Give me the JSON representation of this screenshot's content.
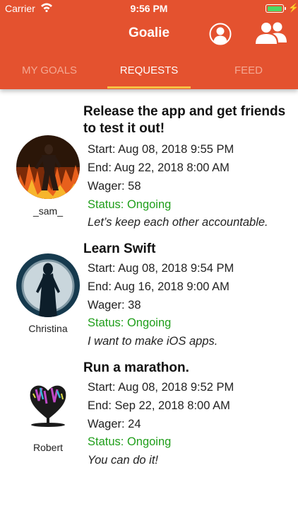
{
  "status_bar": {
    "carrier": "Carrier",
    "time": "9:56 PM"
  },
  "nav": {
    "title": "Goalie"
  },
  "tabs": [
    {
      "label": "MY GOALS",
      "active": false
    },
    {
      "label": "REQUESTS",
      "active": true
    },
    {
      "label": "FEED",
      "active": false
    }
  ],
  "goals": [
    {
      "title": "Release the app and get friends to test it out!",
      "user": "_sam_",
      "start": "Start: Aug 08, 2018 9:55 PM",
      "end": "End: Aug 22, 2018 8:00 AM",
      "wager": "Wager: 58",
      "status": "Status: Ongoing",
      "message": "Let’s keep each other accountable."
    },
    {
      "title": "Learn Swift",
      "user": "Christina",
      "start": "Start: Aug 08, 2018 9:54 PM",
      "end": "End: Aug 16, 2018 9:00 AM",
      "wager": "Wager: 38",
      "status": "Status: Ongoing",
      "message": "I want to make iOS apps."
    },
    {
      "title": "Run a marathon.",
      "user": "Robert",
      "start": "Start: Aug 08, 2018 9:52 PM",
      "end": "End: Sep 22, 2018 8:00 AM",
      "wager": "Wager: 24",
      "status": "Status: Ongoing",
      "message": "You can do it!"
    }
  ],
  "colors": {
    "header": "#e4522f",
    "tab_indicator": "#f7c043",
    "status_ongoing": "#1f9e1a",
    "battery": "#4cd964"
  }
}
